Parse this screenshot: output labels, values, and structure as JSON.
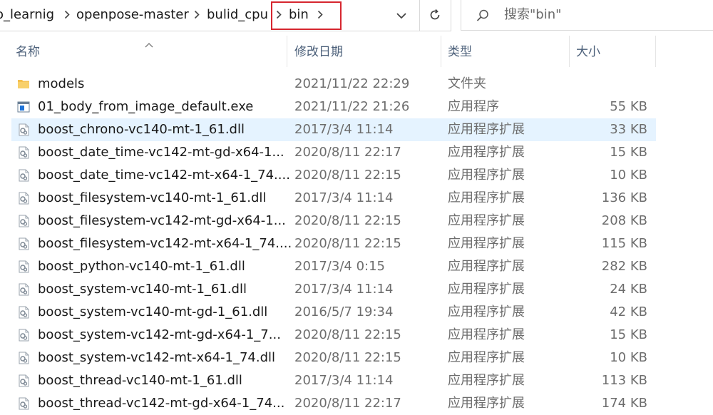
{
  "breadcrumb": {
    "items": [
      "o_learnig",
      "openpose-master",
      "bulid_cpu",
      "bin"
    ]
  },
  "search": {
    "placeholder": "搜索\"bin\""
  },
  "columns": {
    "name": "名称",
    "date": "修改日期",
    "type": "类型",
    "size": "大小"
  },
  "files": [
    {
      "name": "models",
      "date": "2021/11/22 22:29",
      "type": "文件夹",
      "size": "",
      "icon": "folder-icon"
    },
    {
      "name": "01_body_from_image_default.exe",
      "date": "2021/11/22 21:26",
      "type": "应用程序",
      "size": "55 KB",
      "icon": "exe-icon"
    },
    {
      "name": "boost_chrono-vc140-mt-1_61.dll",
      "date": "2017/3/4 11:14",
      "type": "应用程序扩展",
      "size": "33 KB",
      "icon": "dll-icon"
    },
    {
      "name": "boost_date_time-vc142-mt-gd-x64-1...",
      "date": "2020/8/11 22:17",
      "type": "应用程序扩展",
      "size": "15 KB",
      "icon": "dll-icon"
    },
    {
      "name": "boost_date_time-vc142-mt-x64-1_74....",
      "date": "2020/8/11 22:15",
      "type": "应用程序扩展",
      "size": "10 KB",
      "icon": "dll-icon"
    },
    {
      "name": "boost_filesystem-vc140-mt-1_61.dll",
      "date": "2017/3/4 11:14",
      "type": "应用程序扩展",
      "size": "136 KB",
      "icon": "dll-icon"
    },
    {
      "name": "boost_filesystem-vc142-mt-gd-x64-1...",
      "date": "2020/8/11 22:15",
      "type": "应用程序扩展",
      "size": "208 KB",
      "icon": "dll-icon"
    },
    {
      "name": "boost_filesystem-vc142-mt-x64-1_74....",
      "date": "2020/8/11 22:15",
      "type": "应用程序扩展",
      "size": "115 KB",
      "icon": "dll-icon"
    },
    {
      "name": "boost_python-vc140-mt-1_61.dll",
      "date": "2017/3/4 0:15",
      "type": "应用程序扩展",
      "size": "282 KB",
      "icon": "dll-icon"
    },
    {
      "name": "boost_system-vc140-mt-1_61.dll",
      "date": "2017/3/4 11:14",
      "type": "应用程序扩展",
      "size": "24 KB",
      "icon": "dll-icon"
    },
    {
      "name": "boost_system-vc140-mt-gd-1_61.dll",
      "date": "2016/5/7 19:34",
      "type": "应用程序扩展",
      "size": "42 KB",
      "icon": "dll-icon"
    },
    {
      "name": "boost_system-vc142-mt-gd-x64-1_7...",
      "date": "2020/8/11 22:15",
      "type": "应用程序扩展",
      "size": "15 KB",
      "icon": "dll-icon"
    },
    {
      "name": "boost_system-vc142-mt-x64-1_74.dll",
      "date": "2020/8/11 22:15",
      "type": "应用程序扩展",
      "size": "10 KB",
      "icon": "dll-icon"
    },
    {
      "name": "boost_thread-vc140-mt-1_61.dll",
      "date": "2017/3/4 11:14",
      "type": "应用程序扩展",
      "size": "113 KB",
      "icon": "dll-icon"
    },
    {
      "name": "boost_thread-vc142-mt-gd-x64-1_74...",
      "date": "2020/8/11 22:17",
      "type": "应用程序扩展",
      "size": "174 KB",
      "icon": "dll-icon"
    }
  ],
  "selected_index": 2,
  "colors": {
    "selection": "#e5f3ff",
    "highlight_box": "#d6262f",
    "header_text": "#4c607a"
  }
}
